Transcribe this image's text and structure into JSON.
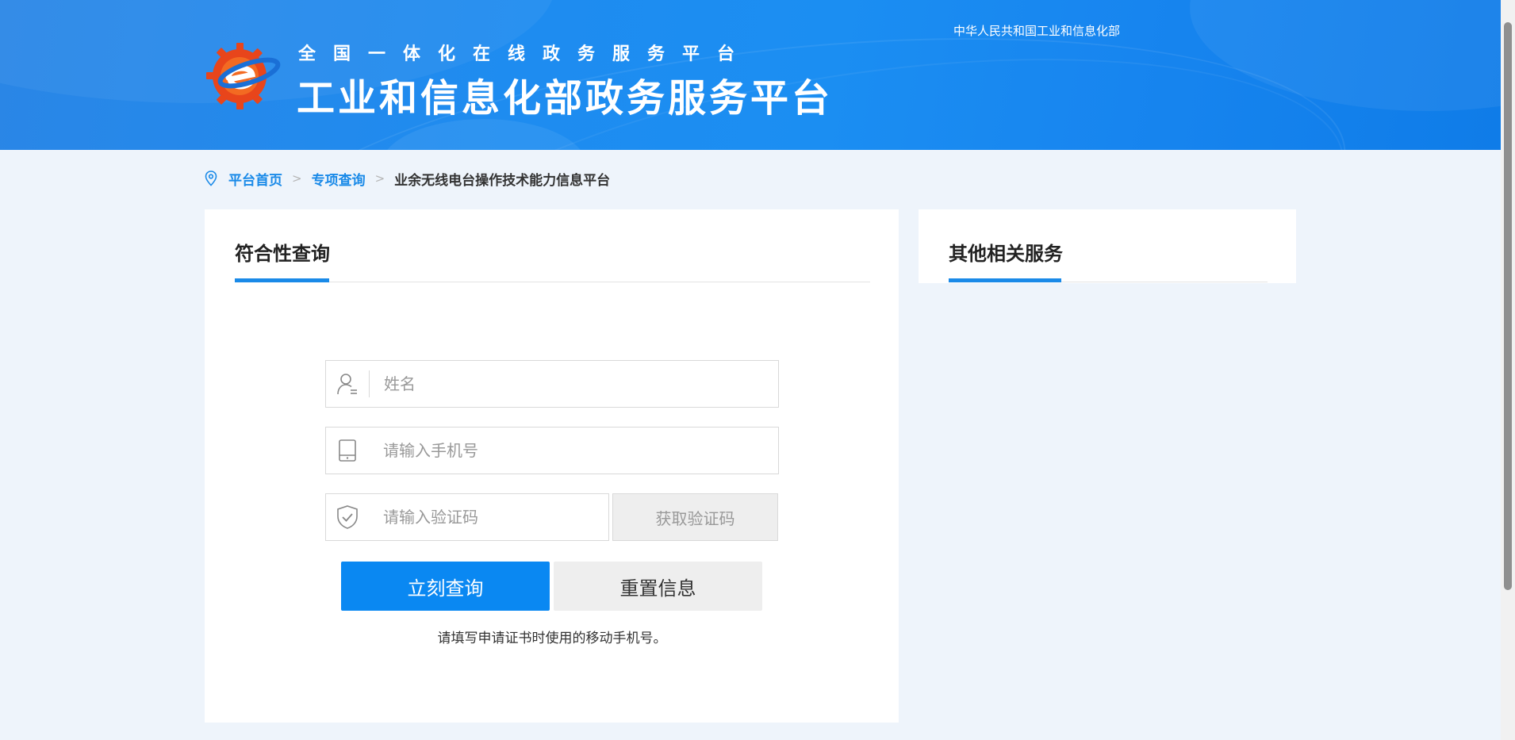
{
  "header": {
    "subtitle": "全国一体化在线政务服务平台",
    "title": "工业和信息化部政务服务平台",
    "ministry_link": "中华人民共和国工业和信息化部"
  },
  "breadcrumb": {
    "items": [
      "平台首页",
      "专项查询"
    ],
    "current": "业余无线电台操作技术能力信息平台",
    "separator": ">"
  },
  "left_panel": {
    "title": "符合性查询",
    "form": {
      "name_placeholder": "姓名",
      "phone_placeholder": "请输入手机号",
      "code_placeholder": "请输入验证码",
      "get_code_label": "获取验证码",
      "query_label": "立刻查询",
      "reset_label": "重置信息",
      "hint": "请填写申请证书时使用的移动手机号。"
    }
  },
  "right_panel": {
    "title": "其他相关服务"
  },
  "colors": {
    "accent": "#1a8ae8",
    "primary_button": "#0a88f2",
    "header_blue": "#1e8cf0",
    "page_bg": "#eef4fb"
  },
  "icons": {
    "location": "location-pin-icon",
    "user": "user-icon",
    "phone": "tablet-phone-icon",
    "shield": "shield-check-icon",
    "logo": "gear-e-logo-icon"
  }
}
